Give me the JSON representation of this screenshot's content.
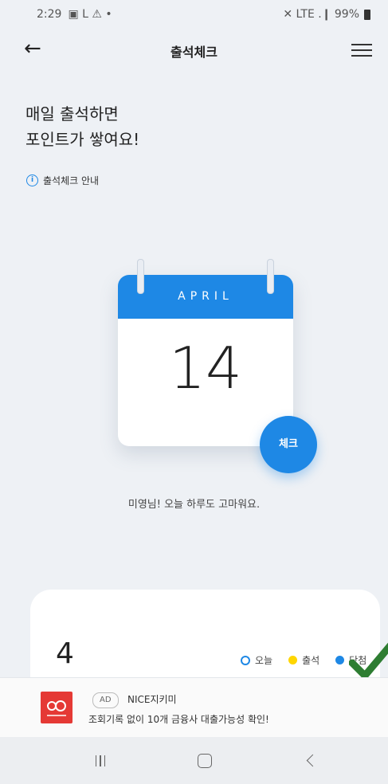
{
  "status_bar": {
    "time": "2:29",
    "left_icons": "▣ L ⚠ •",
    "right_text": "✕ LTE .❙ 99%"
  },
  "app_bar": {
    "title": "출석체크",
    "back_glyph": "←"
  },
  "heading": {
    "line1": "매일 출석하면",
    "line2": "포인트가 쌓여요!"
  },
  "guide": {
    "icon_glyph": "i",
    "label": "출석체크 안내"
  },
  "calendar": {
    "month": "APRIL",
    "day": "14",
    "check_label": "체크"
  },
  "message": "미영님! 오늘 하루도 고마워요.",
  "stats": {
    "count": "4",
    "legend": [
      {
        "label": "오늘",
        "color": "#1e88e5"
      },
      {
        "label": "출석",
        "color": "#ffd600"
      },
      {
        "label": "당첨",
        "color": "#1e88e5"
      }
    ]
  },
  "ad": {
    "badge": "AD",
    "name": "NICE지키미",
    "description": "조회기록 없이 10개 금융사 대출가능성 확인!",
    "logo_color": "#e53935"
  },
  "colors": {
    "accent": "#1e88e5",
    "background": "#eef1f5",
    "checkmark": "#2e7d32"
  }
}
